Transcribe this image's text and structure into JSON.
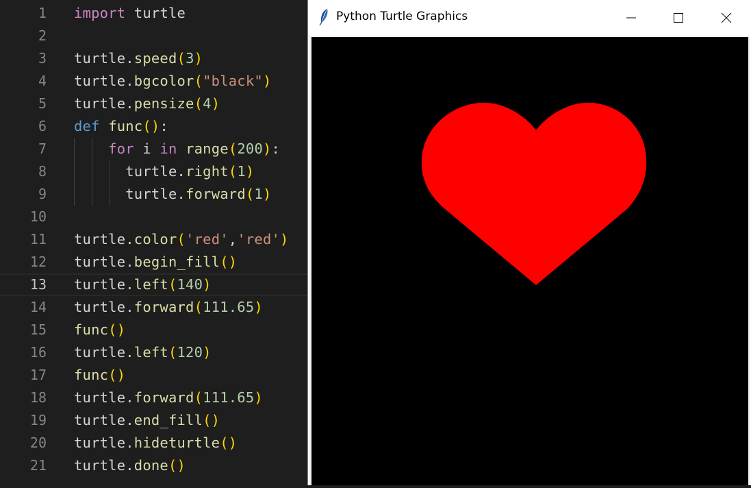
{
  "editor": {
    "lines": [
      {
        "n": "1",
        "tokens": [
          [
            "import",
            "kw"
          ],
          [
            " ",
            "plain"
          ],
          [
            "turtle",
            "plain"
          ]
        ]
      },
      {
        "n": "2",
        "tokens": []
      },
      {
        "n": "3",
        "tokens": [
          [
            "turtle.",
            "plain"
          ],
          [
            "speed",
            "fn"
          ],
          [
            "(",
            "par"
          ],
          [
            "3",
            "num"
          ],
          [
            ")",
            "par"
          ]
        ]
      },
      {
        "n": "4",
        "tokens": [
          [
            "turtle.",
            "plain"
          ],
          [
            "bgcolor",
            "fn"
          ],
          [
            "(",
            "par"
          ],
          [
            "\"black\"",
            "str"
          ],
          [
            ")",
            "par"
          ]
        ]
      },
      {
        "n": "5",
        "tokens": [
          [
            "turtle.",
            "plain"
          ],
          [
            "pensize",
            "fn"
          ],
          [
            "(",
            "par"
          ],
          [
            "4",
            "num"
          ],
          [
            ")",
            "par"
          ]
        ]
      },
      {
        "n": "6",
        "tokens": [
          [
            "def",
            "def"
          ],
          [
            " ",
            "plain"
          ],
          [
            "func",
            "fn"
          ],
          [
            "()",
            "par"
          ],
          [
            ":",
            "plain"
          ]
        ]
      },
      {
        "n": "7",
        "tokens": [
          [
            "    ",
            "plain"
          ],
          [
            "for",
            "kw"
          ],
          [
            " i ",
            "plain"
          ],
          [
            "in",
            "kw"
          ],
          [
            " ",
            "plain"
          ],
          [
            "range",
            "fn"
          ],
          [
            "(",
            "par"
          ],
          [
            "200",
            "num"
          ],
          [
            ")",
            "par"
          ],
          [
            ":",
            "plain"
          ]
        ]
      },
      {
        "n": "8",
        "tokens": [
          [
            "      ",
            "plain"
          ],
          [
            "turtle.",
            "plain"
          ],
          [
            "right",
            "fn"
          ],
          [
            "(",
            "par"
          ],
          [
            "1",
            "num"
          ],
          [
            ")",
            "par"
          ]
        ]
      },
      {
        "n": "9",
        "tokens": [
          [
            "      ",
            "plain"
          ],
          [
            "turtle.",
            "plain"
          ],
          [
            "forward",
            "fn"
          ],
          [
            "(",
            "par"
          ],
          [
            "1",
            "num"
          ],
          [
            ")",
            "par"
          ]
        ]
      },
      {
        "n": "10",
        "tokens": []
      },
      {
        "n": "11",
        "tokens": [
          [
            "turtle.",
            "plain"
          ],
          [
            "color",
            "fn"
          ],
          [
            "(",
            "par"
          ],
          [
            "'red'",
            "str"
          ],
          [
            ",",
            "plain"
          ],
          [
            "'red'",
            "str"
          ],
          [
            ")",
            "par"
          ]
        ]
      },
      {
        "n": "12",
        "tokens": [
          [
            "turtle.",
            "plain"
          ],
          [
            "begin_fill",
            "fn"
          ],
          [
            "()",
            "par"
          ]
        ]
      },
      {
        "n": "13",
        "tokens": [
          [
            "turtle.",
            "plain"
          ],
          [
            "left",
            "fn"
          ],
          [
            "(",
            "par"
          ],
          [
            "140",
            "num"
          ],
          [
            ")",
            "par"
          ]
        ],
        "current": true
      },
      {
        "n": "14",
        "tokens": [
          [
            "turtle.",
            "plain"
          ],
          [
            "forward",
            "fn"
          ],
          [
            "(",
            "par"
          ],
          [
            "111.65",
            "num"
          ],
          [
            ")",
            "par"
          ]
        ]
      },
      {
        "n": "15",
        "tokens": [
          [
            "func",
            "fn"
          ],
          [
            "()",
            "par"
          ]
        ]
      },
      {
        "n": "16",
        "tokens": [
          [
            "turtle.",
            "plain"
          ],
          [
            "left",
            "fn"
          ],
          [
            "(",
            "par"
          ],
          [
            "120",
            "num"
          ],
          [
            ")",
            "par"
          ]
        ]
      },
      {
        "n": "17",
        "tokens": [
          [
            "func",
            "fn"
          ],
          [
            "()",
            "par"
          ]
        ]
      },
      {
        "n": "18",
        "tokens": [
          [
            "turtle.",
            "plain"
          ],
          [
            "forward",
            "fn"
          ],
          [
            "(",
            "par"
          ],
          [
            "111.65",
            "num"
          ],
          [
            ")",
            "par"
          ]
        ]
      },
      {
        "n": "19",
        "tokens": [
          [
            "turtle.",
            "plain"
          ],
          [
            "end_fill",
            "fn"
          ],
          [
            "()",
            "par"
          ]
        ]
      },
      {
        "n": "20",
        "tokens": [
          [
            "turtle.",
            "plain"
          ],
          [
            "hideturtle",
            "fn"
          ],
          [
            "()",
            "par"
          ]
        ]
      },
      {
        "n": "21",
        "tokens": [
          [
            "turtle.",
            "plain"
          ],
          [
            "done",
            "fn"
          ],
          [
            "()",
            "par"
          ]
        ]
      }
    ],
    "colors": {
      "plain": "#d4d4d4",
      "kw": "#c586c0",
      "def": "#569cd6",
      "fn": "#dcdcaa",
      "str": "#ce9178",
      "num": "#b5cea8",
      "par": "#ffd700"
    }
  },
  "window": {
    "title": "Python Turtle Graphics",
    "icon": "feather-icon",
    "controls": [
      "minimize-icon",
      "maximize-icon",
      "close-icon"
    ],
    "canvas": {
      "background": "#000000",
      "heart_color": "#ff0000"
    }
  }
}
